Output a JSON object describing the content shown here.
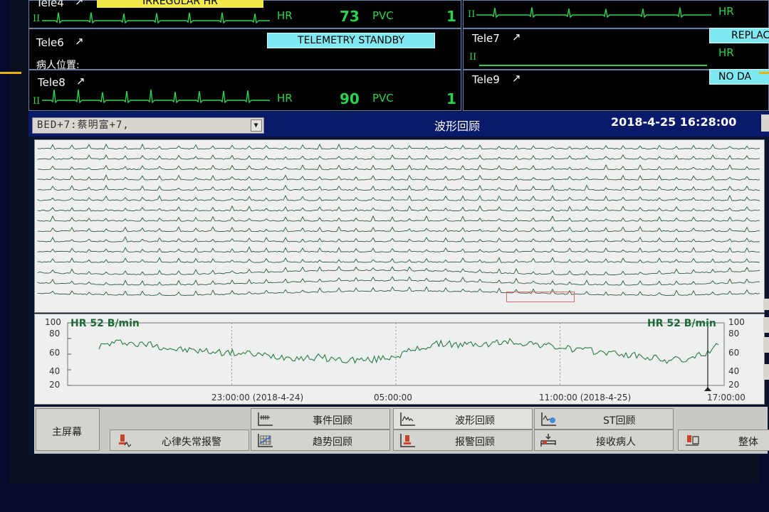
{
  "telemetry": {
    "tele4": {
      "name": "Tele4",
      "warning": "IRREGULAR HR",
      "lead": "II",
      "hr_label": "HR",
      "hr_value": "73",
      "pvc_label": "PVC",
      "pvc_value": "1"
    },
    "tele6": {
      "name": "Tele6",
      "status": "TELEMETRY STANDBY",
      "location_label": "病人位置:"
    },
    "tele8": {
      "name": "Tele8",
      "lead": "II",
      "hr_label": "HR",
      "hr_value": "90",
      "pvc_label": "PVC",
      "pvc_value": "1"
    },
    "tele5": {
      "lead": "II",
      "hr_label": "HR"
    },
    "tele7": {
      "name": "Tele7",
      "status": "REPLAC",
      "lead": "II",
      "hr_label": "HR"
    },
    "tele9": {
      "name": "Tele9",
      "status": "NO DA"
    }
  },
  "header": {
    "bed_selector": "BED+7:蔡明富+7,",
    "title": "波形回顾",
    "datetime": "2018-4-25 16:28:00"
  },
  "trend": {
    "hr_left": "HR 52 B/min",
    "hr_right": "HR 52 B/min",
    "y_ticks": [
      "100",
      "80",
      "60",
      "40",
      "20"
    ],
    "x_ticks": [
      "23:00:00 (2018-4-24)",
      "05:00:00",
      "11:00:00 (2018-4-25)",
      "17:00:00"
    ]
  },
  "buttons": {
    "main_screen": "主屏幕",
    "arrhythmia_alarm": "心律失常报警",
    "event_review": "事件回顾",
    "trend_review": "趋势回顾",
    "waveform_review": "波形回顾",
    "alarm_review": "报警回顾",
    "st_review": "ST回顾",
    "admit_patient": "接收病人",
    "overall": "整体"
  },
  "colors": {
    "waveform_green": "#2bd24f",
    "status_cyan": "#7fe8f0",
    "warning_yellow": "#f2ea4a",
    "header_blue": "#0a1a6a",
    "trend_green": "#1f6a3a"
  },
  "chart_data": {
    "type": "line",
    "title": "",
    "ylim": [
      20,
      100
    ],
    "y_ticks": [
      20,
      40,
      60,
      80,
      100
    ],
    "x_ticks": [
      "23:00:00 (2018-4-24)",
      "05:00:00",
      "11:00:00 (2018-4-25)",
      "17:00:00"
    ],
    "series": [
      {
        "name": "HR",
        "values": [
          70,
          74,
          76,
          72,
          73,
          69,
          66,
          65,
          64,
          63,
          62,
          61,
          60,
          58,
          57,
          56,
          55,
          56,
          54,
          52,
          53,
          52,
          55,
          58,
          63,
          68,
          72,
          74,
          71,
          73,
          72,
          75,
          76,
          74,
          73,
          70,
          68,
          66,
          64,
          63,
          61,
          59,
          57,
          55,
          52,
          53,
          54,
          62,
          72
        ]
      }
    ]
  }
}
